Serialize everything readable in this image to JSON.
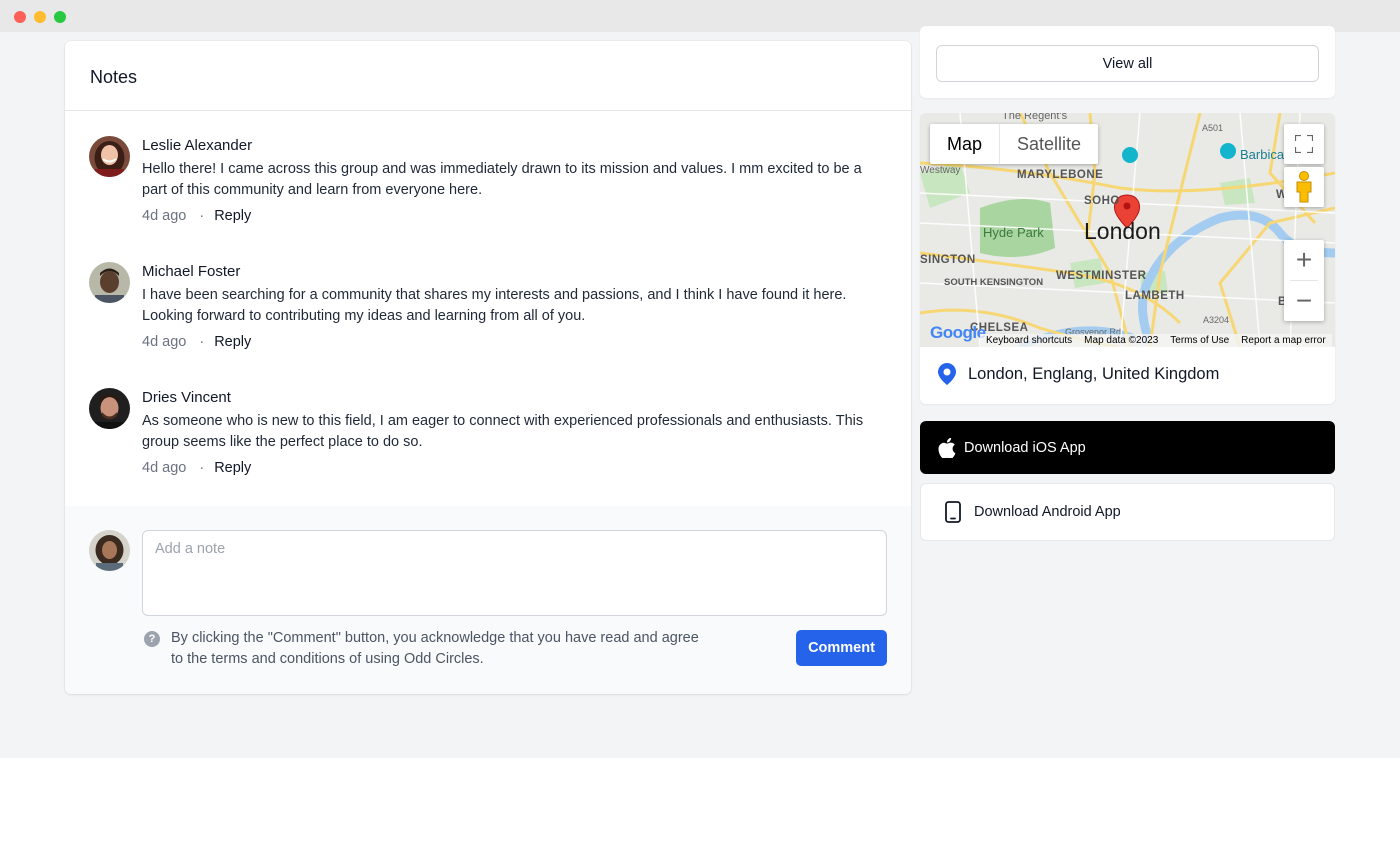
{
  "window": {
    "controls": [
      "close",
      "minimize",
      "maximize"
    ]
  },
  "notes": {
    "title": "Notes",
    "comments": [
      {
        "author": "Leslie Alexander",
        "text": "Hello there! I came across this group and was immediately drawn to its mission and values. I mm excited to be a part of this community and learn from everyone here.",
        "time": "4d ago",
        "reply_label": "Reply"
      },
      {
        "author": "Michael Foster",
        "text": "I have been searching for a community that shares my interests and passions, and I think I have found it here. Looking forward to contributing my ideas and learning from all of you.",
        "time": "4d ago",
        "reply_label": "Reply"
      },
      {
        "author": "Dries Vincent",
        "text": "As someone who is new to this field, I am eager to connect with experienced professionals and enthusiasts. This group seems like the perfect place to do so.",
        "time": "4d ago",
        "reply_label": "Reply"
      }
    ],
    "separator": "·",
    "composer": {
      "placeholder": "Add a note",
      "value": "",
      "help_icon": "?",
      "disclaimer": "By clicking the \"Comment\" button, you acknowledge that you have read and agree to the terms and conditions of using Odd Circles.",
      "submit_label": "Comment"
    }
  },
  "sidebar": {
    "view_all_label": "View all",
    "map": {
      "tabs": [
        "Map",
        "Satellite"
      ],
      "active_tab": "Map",
      "labels": {
        "city": "London",
        "marylebone": "MARYLEBONE",
        "soho": "SOHO",
        "hyde_park": "Hyde Park",
        "westminster": "WESTMINSTER",
        "lambeth": "LAMBETH",
        "south_kensington": "SOUTH\nKENSINGTON",
        "kensington": "SINGTON",
        "chelsea": "CHELSEA",
        "barbican": "Barbica",
        "whitechapel": "WHI",
        "bermondsey": "BE",
        "westway": "Westway",
        "regents": "The Regent's",
        "a501": "A501",
        "a3204": "A3204",
        "grosvenor": "Grosvenor Rd"
      },
      "zoom_in": "+",
      "zoom_out": "−",
      "google": "Google",
      "footer": [
        "Keyboard shortcuts",
        "Map data ©2023",
        "Terms of Use",
        "Report a map error"
      ]
    },
    "location": "London, Englang, United Kingdom",
    "ios_label": "Download iOS App",
    "android_label": "Download Android App"
  },
  "colors": {
    "accent": "#2563eb",
    "page_bg": "#f3f4f6",
    "map_pin": "#ea4335",
    "location_pin": "#2563eb"
  },
  "icons": [
    "apple-icon",
    "phone-icon",
    "location-pin-icon",
    "question-icon",
    "fullscreen-icon",
    "pegman-icon"
  ]
}
